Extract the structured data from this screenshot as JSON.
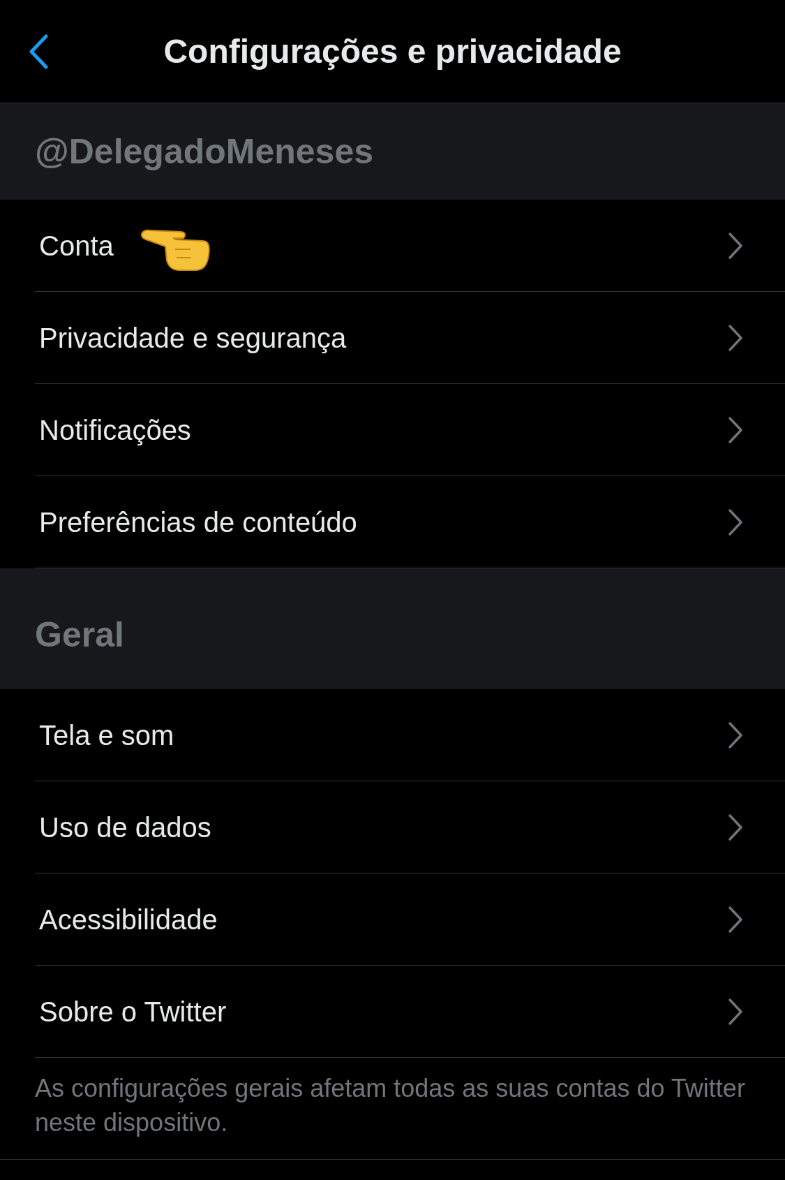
{
  "header": {
    "title": "Configurações e privacidade"
  },
  "sections": [
    {
      "title": "@DelegadoMeneses",
      "rows": [
        {
          "label": "Conta",
          "pointed": true
        },
        {
          "label": "Privacidade e segurança",
          "pointed": false
        },
        {
          "label": "Notificações",
          "pointed": false
        },
        {
          "label": "Preferências de conteúdo",
          "pointed": false
        }
      ]
    },
    {
      "title": "Geral",
      "rows": [
        {
          "label": "Tela e som",
          "pointed": false
        },
        {
          "label": "Uso de dados",
          "pointed": false
        },
        {
          "label": "Acessibilidade",
          "pointed": false
        },
        {
          "label": "Sobre o Twitter",
          "pointed": false
        }
      ],
      "footer": "As configurações gerais afetam todas as suas contas do Twitter neste dispositivo."
    }
  ]
}
